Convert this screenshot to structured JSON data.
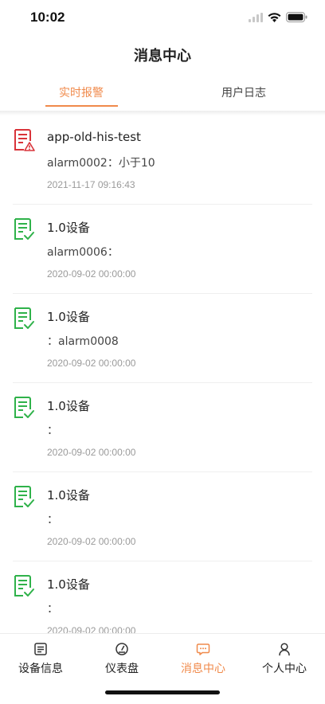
{
  "status": {
    "time": "10:02"
  },
  "header": {
    "title": "消息中心"
  },
  "tabs": [
    {
      "label": "实时报警",
      "active": true
    },
    {
      "label": "用户日志",
      "active": false
    }
  ],
  "messages": [
    {
      "title": "app-old-his-test",
      "message": "alarm0002：小于10",
      "time": "2021-11-17 09:16:43",
      "level": "alarm",
      "icon": "document-warning-icon"
    },
    {
      "title": "1.0设备",
      "message": "alarm0006：",
      "time": "2020-09-02 00:00:00",
      "level": "normal",
      "icon": "document-check-icon"
    },
    {
      "title": "1.0设备",
      "message": "：alarm0008",
      "time": "2020-09-02 00:00:00",
      "level": "normal",
      "icon": "document-check-icon"
    },
    {
      "title": "1.0设备",
      "message": "：",
      "time": "2020-09-02 00:00:00",
      "level": "normal",
      "icon": "document-check-icon"
    },
    {
      "title": "1.0设备",
      "message": "：",
      "time": "2020-09-02 00:00:00",
      "level": "normal",
      "icon": "document-check-icon"
    },
    {
      "title": "1.0设备",
      "message": "：",
      "time": "2020-09-02 00:00:00",
      "level": "normal",
      "icon": "document-check-icon"
    }
  ],
  "nav": [
    {
      "label": "设备信息",
      "icon": "device-info-icon",
      "active": false
    },
    {
      "label": "仪表盘",
      "icon": "dashboard-icon",
      "active": false
    },
    {
      "label": "消息中心",
      "icon": "message-icon",
      "active": true
    },
    {
      "label": "个人中心",
      "icon": "profile-icon",
      "active": false
    }
  ],
  "colors": {
    "accent": "#f08a4b",
    "alarm": "#d9343a",
    "ok": "#2fb24a"
  }
}
